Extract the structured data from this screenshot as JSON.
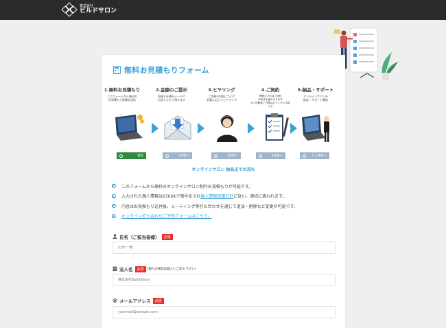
{
  "header": {
    "logo_sub": "株式会社",
    "logo_main": "ビルドサロン"
  },
  "form": {
    "title": "無料お見積もりフォーム",
    "steps": [
      {
        "title": "1.無料お見積もり",
        "desc": "このフォームから無料の\nお見積もり依頼を送信",
        "badge": "現在",
        "state": "current"
      },
      {
        "title": "2.金額のご提示",
        "desc": "金額と仕様をメールで\nお送りさせて頂きます",
        "badge": "1日後〜",
        "state": "later"
      },
      {
        "title": "3.ヒヤリング",
        "desc": "ご予算や内容について\n必要に応じてヒヤリング",
        "badge": "2日後〜",
        "state": "later"
      },
      {
        "title": "4.ご契約",
        "desc": "問題なければご契約\n手続きを進めらせます\n※ご依頼後７日間はキャンセル可能です",
        "badge": "3日後〜",
        "state": "later"
      },
      {
        "title": "5.納品・サポート",
        "desc": "オンラインサロンを\n納品・サポート開始",
        "badge": "１ヶ月後〜",
        "state": "later"
      }
    ],
    "flow_caption": "オンラインサロン 納品までの流れ",
    "notes": [
      {
        "text": "このフォームから無料のオンラインサロン制作お見積もりが可能です。"
      },
      {
        "pre": "入力された個人情報は256bitで暗号化され",
        "link": "個人情報保護方針",
        "post": "に従い、適切に扱われます。"
      },
      {
        "text": "内容はお見積もり送付後、ミーティング等打ち合わせを通じて追加・削除など変更が可能です。"
      },
      {
        "link": "オンライン打ち合わせご予約フォームはこちら。"
      }
    ],
    "fields": [
      {
        "label": "氏名（ご担当者様）",
        "required": "必須",
        "hint": "",
        "placeholder": "山田 一郎",
        "icon": "person-icon"
      },
      {
        "label": "法人名",
        "required": "必須",
        "hint": "(個人の場合は個人とご記入下さい)",
        "placeholder": "株式会社BuildSalon",
        "icon": "building-icon"
      },
      {
        "label": "メールアドレス",
        "required": "必須",
        "hint": "",
        "placeholder": "yourmail@domain.com",
        "icon": "at-icon"
      }
    ]
  },
  "colors": {
    "accent": "#3aa0d8",
    "required": "#e5312d",
    "current_badge": "#2e8b3d",
    "later_badge": "#9fb4c8",
    "topbar": "#2b2b2b"
  }
}
